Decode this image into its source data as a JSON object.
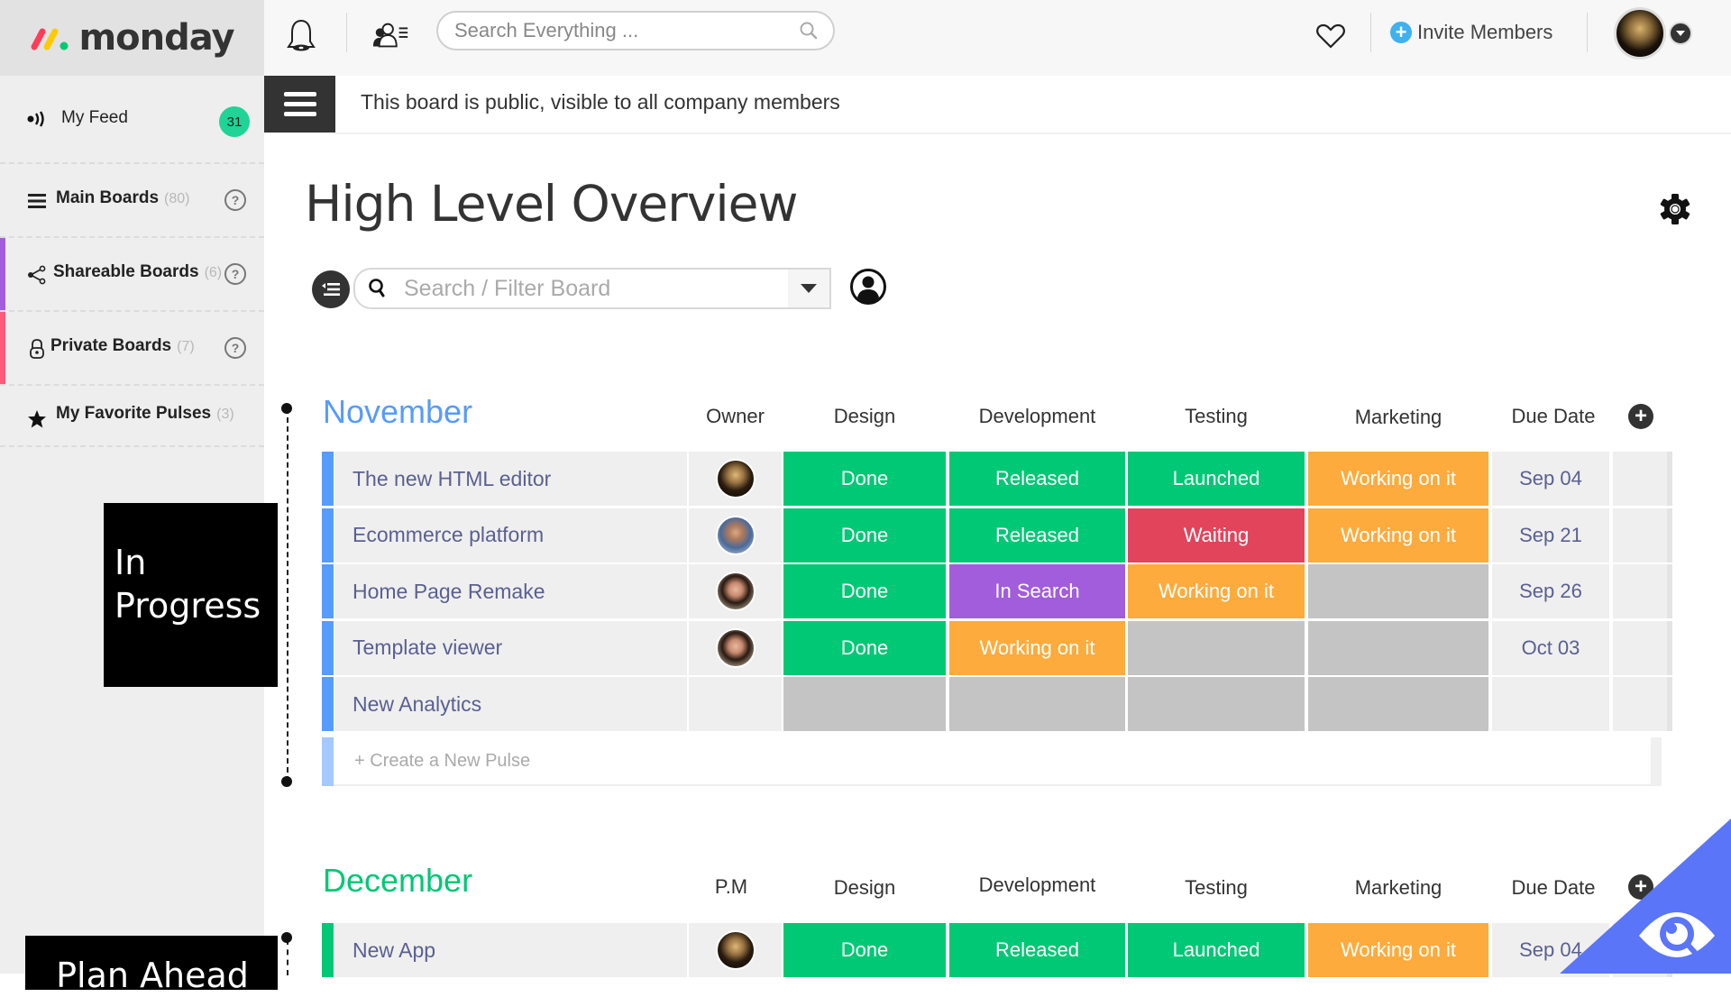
{
  "app": {
    "logo_text": "monday",
    "logo_colors": [
      "#ff3d57",
      "#ffcb00",
      "#00ca72"
    ]
  },
  "topbar": {
    "notifications_icon": "bell-icon",
    "people_icon": "people-list-icon",
    "search_placeholder": "Search Everything ...",
    "search_value": "",
    "favorites_icon": "heart-icon",
    "invite_label": "Invite Members",
    "invite_icon": "plus-circle-icon",
    "user_menu_icon": "caret-down-icon"
  },
  "sidebar": {
    "items": [
      {
        "label": "My Feed",
        "icon": "feed-icon",
        "badge": "31"
      },
      {
        "label": "Main Boards",
        "count": "(80)",
        "icon": "list-icon",
        "help": "?"
      },
      {
        "label": "Shareable Boards",
        "count": "(6)",
        "icon": "share-icon",
        "help": "?",
        "accent": "#a25ddc"
      },
      {
        "label": "Private Boards",
        "count": "(7)",
        "icon": "lock-icon",
        "help": "?",
        "accent": "#ff5a7a"
      },
      {
        "label": "My Favorite Pulses",
        "count": "(3)",
        "icon": "star-icon"
      }
    ],
    "stage_labels": [
      "In Progress",
      "Plan Ahead"
    ]
  },
  "board": {
    "notice": "This board is public, visible to all company members",
    "title": "High Level Overview",
    "filter_placeholder": "Search / Filter Board",
    "filter_value": ""
  },
  "groups": [
    {
      "title": "November",
      "color": "#579bfc",
      "columns": [
        "Owner",
        "Design",
        "Development",
        "Testing",
        "Marketing",
        "Due Date"
      ],
      "rows": [
        {
          "name": "The new HTML editor",
          "owner": "avatar-woman-dark",
          "design": "Done",
          "development": "Released",
          "testing": "Launched",
          "marketing": "Working on it",
          "due": "Sep 04"
        },
        {
          "name": "Ecommerce platform",
          "owner": "avatar-man",
          "design": "Done",
          "development": "Released",
          "testing": "Waiting",
          "marketing": "Working on it",
          "due": "Sep 21"
        },
        {
          "name": "Home Page Remake",
          "owner": "avatar-woman",
          "design": "Done",
          "development": "In Search",
          "testing": "Working on it",
          "marketing": "",
          "due": "Sep 26"
        },
        {
          "name": "Template viewer",
          "owner": "avatar-woman",
          "design": "Done",
          "development": "Working on it",
          "testing": "",
          "marketing": "",
          "due": "Oct 03"
        },
        {
          "name": "New Analytics",
          "owner": "",
          "design": "",
          "development": "",
          "testing": "",
          "marketing": "",
          "due": ""
        }
      ],
      "create_label": "+ Create a New Pulse"
    },
    {
      "title": "December",
      "color": "#00c875",
      "columns": [
        "P.M",
        "Design",
        "Development",
        "Testing",
        "Marketing",
        "Due Date"
      ],
      "rows": [
        {
          "name": "New App",
          "owner": "avatar-woman-dark",
          "design": "Done",
          "development": "Released",
          "testing": "Launched",
          "marketing": "Working on it",
          "due": "Sep 04"
        }
      ]
    }
  ],
  "status_colors": {
    "Done": "#00c875",
    "Released": "#00c875",
    "Launched": "#00c875",
    "Working on it": "#fdab3d",
    "Waiting": "#e2445c",
    "In Search": "#a25ddc",
    "": "#c4c4c4"
  }
}
